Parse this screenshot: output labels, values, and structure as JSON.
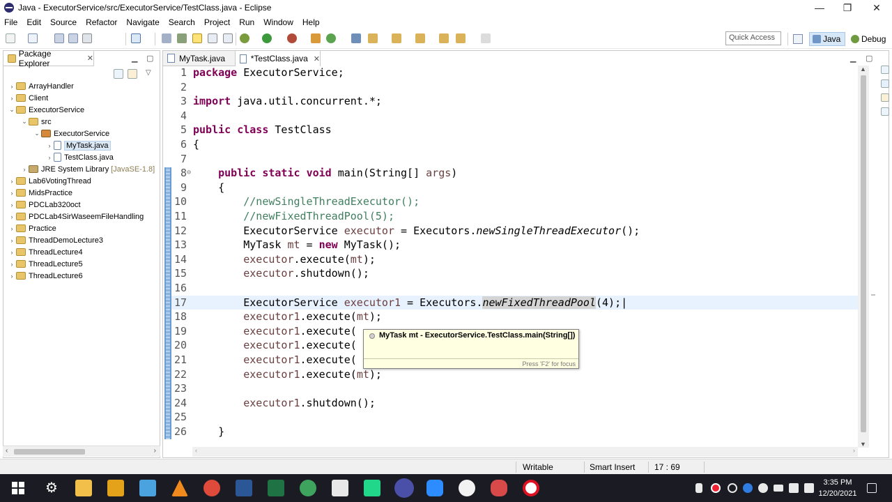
{
  "window": {
    "title": "Java - ExecutorService/src/ExecutorService/TestClass.java - Eclipse"
  },
  "menu": [
    "File",
    "Edit",
    "Source",
    "Refactor",
    "Navigate",
    "Search",
    "Project",
    "Run",
    "Window",
    "Help"
  ],
  "toolbar": {
    "quick_access_placeholder": "Quick Access",
    "perspective_java": "Java",
    "perspective_debug": "Debug"
  },
  "package_explorer": {
    "title": "Package Explorer",
    "tree": [
      {
        "label": "ArrayHandler",
        "depth": 0,
        "arrow": ">",
        "icon": "project-folder-icon"
      },
      {
        "label": "Client",
        "depth": 0,
        "arrow": ">",
        "icon": "project-folder-icon"
      },
      {
        "label": "ExecutorService",
        "depth": 0,
        "arrow": "v",
        "icon": "project-folder-icon"
      },
      {
        "label": "src",
        "depth": 1,
        "arrow": "v",
        "icon": "source-folder-icon"
      },
      {
        "label": "ExecutorService",
        "depth": 2,
        "arrow": "v",
        "icon": "package-icon"
      },
      {
        "label": "MyTask.java",
        "depth": 3,
        "arrow": ">",
        "icon": "java-file-icon",
        "selected": true
      },
      {
        "label": "TestClass.java",
        "depth": 3,
        "arrow": ">",
        "icon": "java-file-icon"
      },
      {
        "label": "JRE System Library",
        "tag": "[JavaSE-1.8]",
        "depth": 1,
        "arrow": ">",
        "icon": "library-icon"
      },
      {
        "label": "Lab6VotingThread",
        "depth": 0,
        "arrow": ">",
        "icon": "project-folder-icon"
      },
      {
        "label": "MidsPractice",
        "depth": 0,
        "arrow": ">",
        "icon": "project-folder-icon"
      },
      {
        "label": "PDCLab320oct",
        "depth": 0,
        "arrow": ">",
        "icon": "project-folder-icon"
      },
      {
        "label": "PDCLab4SirWaseemFileHandling",
        "depth": 0,
        "arrow": ">",
        "icon": "project-folder-icon"
      },
      {
        "label": "Practice",
        "depth": 0,
        "arrow": ">",
        "icon": "project-folder-icon"
      },
      {
        "label": "ThreadDemoLecture3",
        "depth": 0,
        "arrow": ">",
        "icon": "project-folder-icon"
      },
      {
        "label": "ThreadLecture4",
        "depth": 0,
        "arrow": ">",
        "icon": "project-folder-icon"
      },
      {
        "label": "ThreadLecture5",
        "depth": 0,
        "arrow": ">",
        "icon": "project-folder-icon"
      },
      {
        "label": "ThreadLecture6",
        "depth": 0,
        "arrow": ">",
        "icon": "project-folder-icon"
      }
    ]
  },
  "editor": {
    "tabs": [
      {
        "label": "MyTask.java",
        "active": false
      },
      {
        "label": "*TestClass.java",
        "active": true
      }
    ],
    "lines": [
      {
        "n": "1",
        "html": "<span class=\"kw\">package</span> ExecutorService;"
      },
      {
        "n": "2",
        "html": ""
      },
      {
        "n": "3",
        "html": "<span class=\"kw\">import</span> java.util.concurrent.*;"
      },
      {
        "n": "4",
        "html": ""
      },
      {
        "n": "5",
        "html": "<span class=\"kw\">public</span> <span class=\"kw\">class</span> TestClass"
      },
      {
        "n": "6",
        "html": "{"
      },
      {
        "n": "7",
        "html": ""
      },
      {
        "n": "8",
        "html": "    <span class=\"kw\">public</span> <span class=\"kw\">static</span> <span class=\"kw\">void</span> main(String[] <span class=\"lv\">args</span>)",
        "fold": true
      },
      {
        "n": "9",
        "html": "    {"
      },
      {
        "n": "10",
        "html": "        <span class=\"cm\">//newSingleThreadExecutor();</span>"
      },
      {
        "n": "11",
        "html": "        <span class=\"cm\">//newFixedThreadPool(5);</span>"
      },
      {
        "n": "12",
        "html": "        ExecutorService <span class=\"lv\">executor</span> = Executors.<span class=\"st\">newSingleThreadExecutor</span>();"
      },
      {
        "n": "13",
        "html": "        MyTask <span class=\"lv\">mt</span> = <span class=\"kw\">new</span> MyTask();"
      },
      {
        "n": "14",
        "html": "        <span class=\"lv\">executor</span>.execute(<span class=\"lv\">mt</span>);"
      },
      {
        "n": "15",
        "html": "        <span class=\"lv\">executor</span>.shutdown();"
      },
      {
        "n": "16",
        "html": ""
      },
      {
        "n": "17",
        "html": "        ExecutorService <span class=\"lv\">executor1</span> = Executors.<span class=\"st hl\">newFixedThreadPool</span>(4);|",
        "current": true
      },
      {
        "n": "18",
        "html": "        <span class=\"lv\">executor1</span>.execute(<span class=\"lv\">mt</span>);"
      },
      {
        "n": "19",
        "html": "        <span class=\"lv\">executor1</span>.execute("
      },
      {
        "n": "20",
        "html": "        <span class=\"lv\">executor1</span>.execute("
      },
      {
        "n": "21",
        "html": "        <span class=\"lv\">executor1</span>.execute("
      },
      {
        "n": "22",
        "html": "        <span class=\"lv\">executor1</span>.execute(<span class=\"lv\">mt</span>);"
      },
      {
        "n": "23",
        "html": ""
      },
      {
        "n": "24",
        "html": "        <span class=\"lv\">executor1</span>.shutdown();"
      },
      {
        "n": "25",
        "html": ""
      },
      {
        "n": "26",
        "html": "    }"
      }
    ]
  },
  "hover_tooltip": {
    "text": "MyTask mt - ExecutorService.TestClass.main(String[])",
    "footer": "Press 'F2' for focus"
  },
  "status": {
    "writable": "Writable",
    "insert_mode": "Smart Insert",
    "position": "17 : 69"
  },
  "taskbar": {
    "time": "3:35 PM",
    "date": "12/20/2021"
  },
  "colors": {
    "keyword": "#7f0055",
    "comment": "#3f7f5f",
    "local_var": "#6a3e3e",
    "taskbar": "#1b1b24"
  }
}
